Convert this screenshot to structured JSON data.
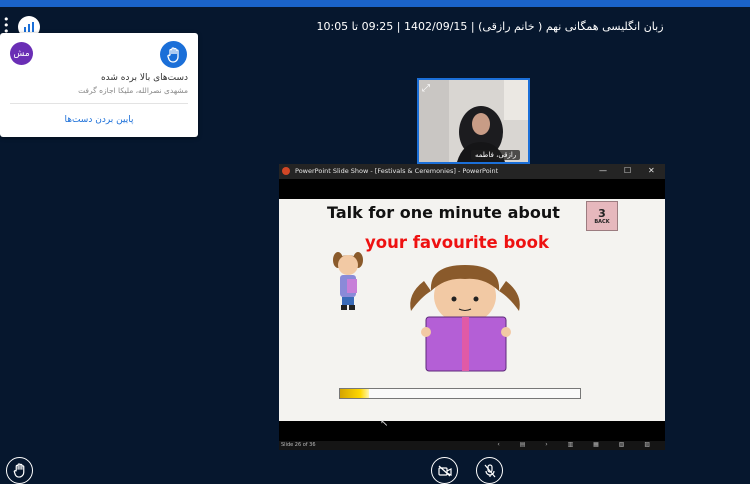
{
  "session": {
    "title": "زبان انگلیسی همگانی نهم ( خانم رازقی) | 1402/09/15 | 09:25 تا 10:05"
  },
  "notification": {
    "avatar_initials": "مش",
    "title": "دست‌های بالا برده شده",
    "subtitle": "مشهدی نصرالله، ملیکا اجازه گرفت",
    "action_label": "پایین بردن دست‌ها"
  },
  "webcam": {
    "name": "رازقی، فاطمه"
  },
  "powerpoint": {
    "window_title": "PowerPoint Slide Show - [Festivals & Ceremonies] - PowerPoint",
    "slide": {
      "line1": "Talk for one minute about",
      "line2": "your favourite book",
      "back_number": "3",
      "back_label": "BACK",
      "progress_fraction": 0.12
    },
    "status_text": "Slide 26 of 36"
  },
  "colors": {
    "accent": "#1b6fd8",
    "avatar": "#6a2eb5",
    "slide_red": "#ee1111"
  },
  "icons": [
    "hand-raise-icon",
    "webcam-off-icon",
    "mic-off-icon",
    "expand-icon"
  ]
}
